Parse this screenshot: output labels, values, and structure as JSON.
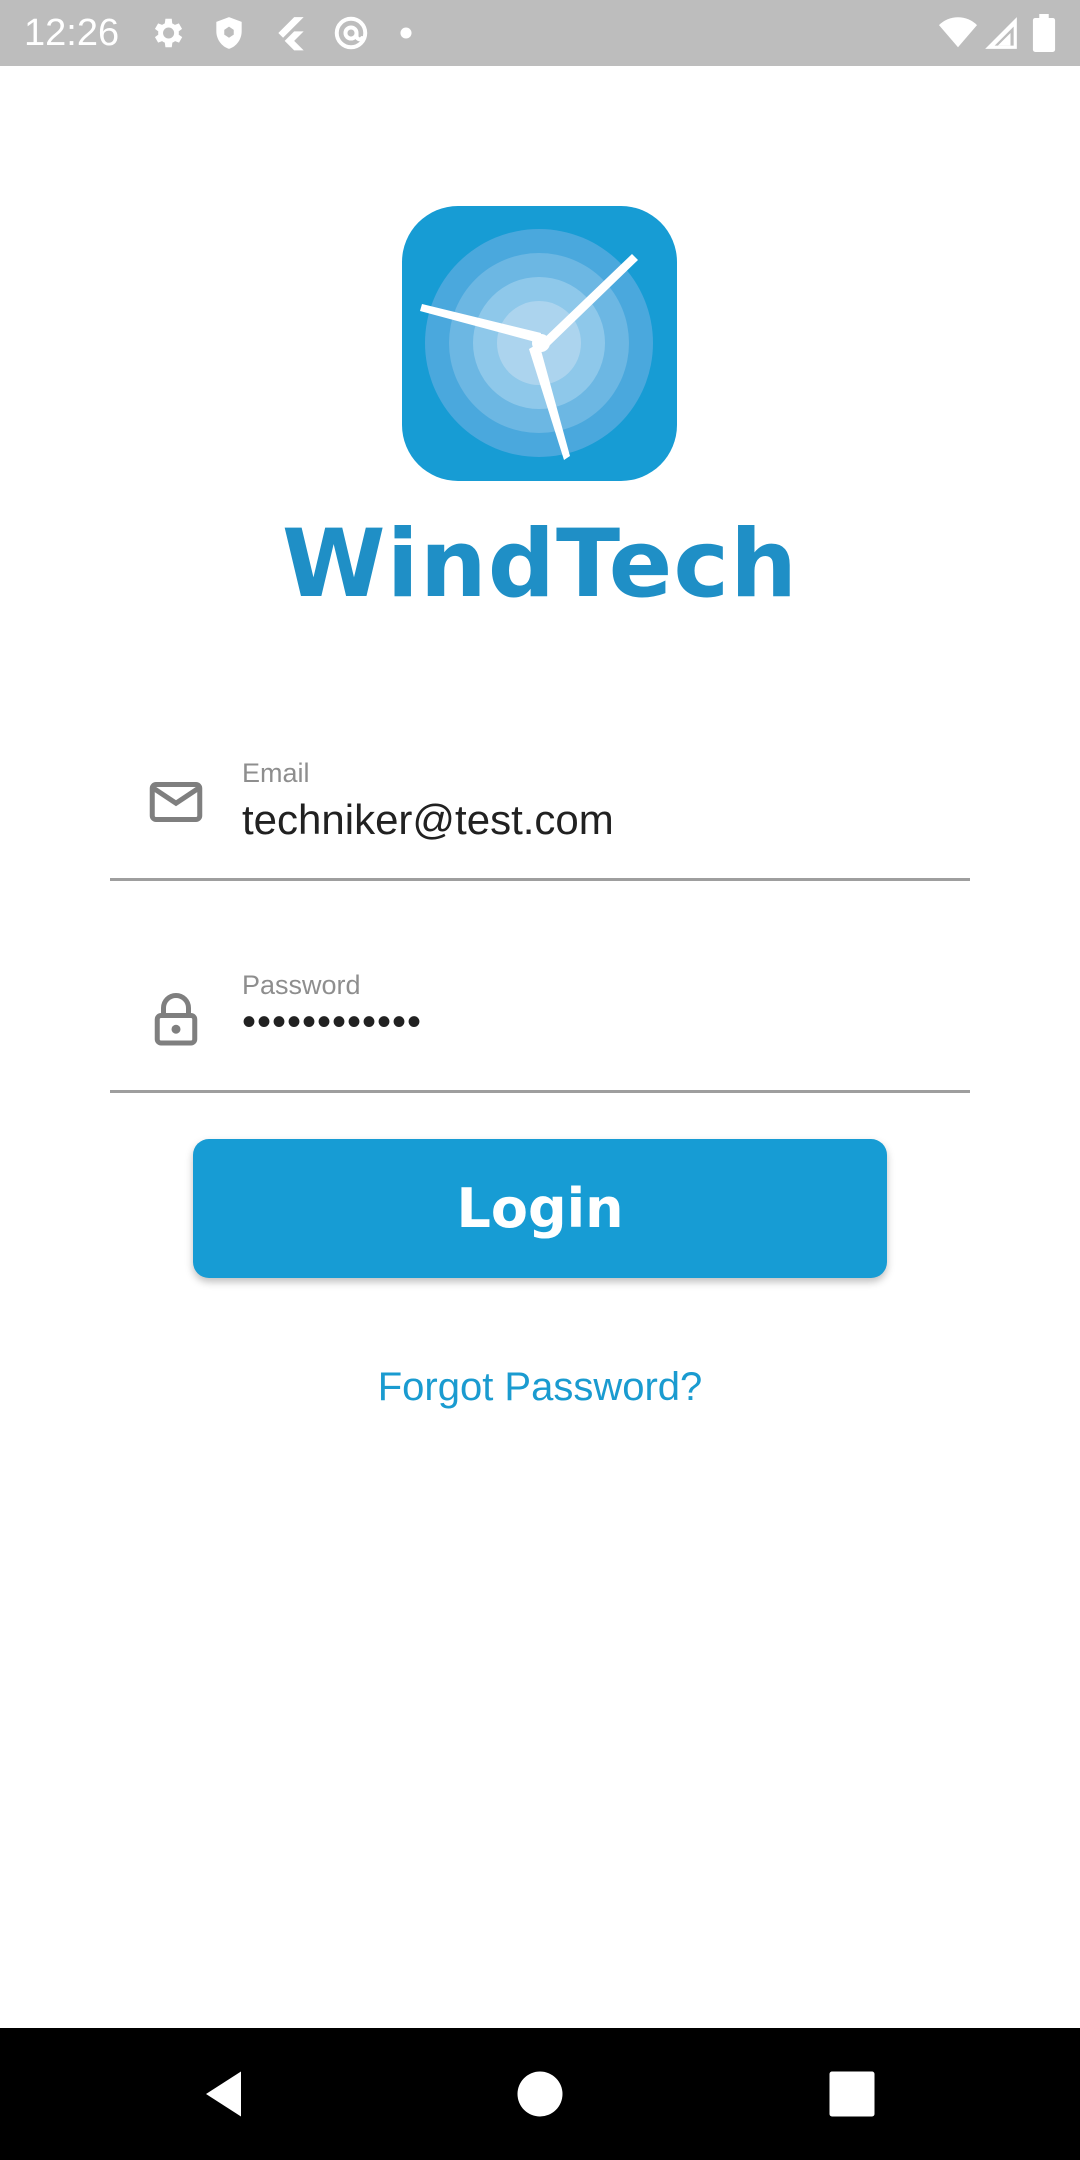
{
  "status_bar": {
    "time": "12:26",
    "left_icons": [
      "settings-icon",
      "shield-icon",
      "flutter-icon",
      "at-sign-icon",
      "dot-icon"
    ],
    "right_icons": [
      "wifi-icon",
      "signal-icon",
      "battery-icon"
    ]
  },
  "app": {
    "name": "WindTech",
    "brand_color": "#179cd4",
    "logo_icon": "wind-turbine-icon"
  },
  "form": {
    "email": {
      "label": "Email",
      "value": "techniker@test.com",
      "icon": "mail-icon"
    },
    "password": {
      "label": "Password",
      "value": "••••••••••••",
      "icon": "lock-icon"
    },
    "login_label": "Login",
    "forgot_label": "Forgot Password?"
  },
  "nav_bar": {
    "buttons": [
      "back-icon",
      "home-icon",
      "recents-icon"
    ]
  }
}
